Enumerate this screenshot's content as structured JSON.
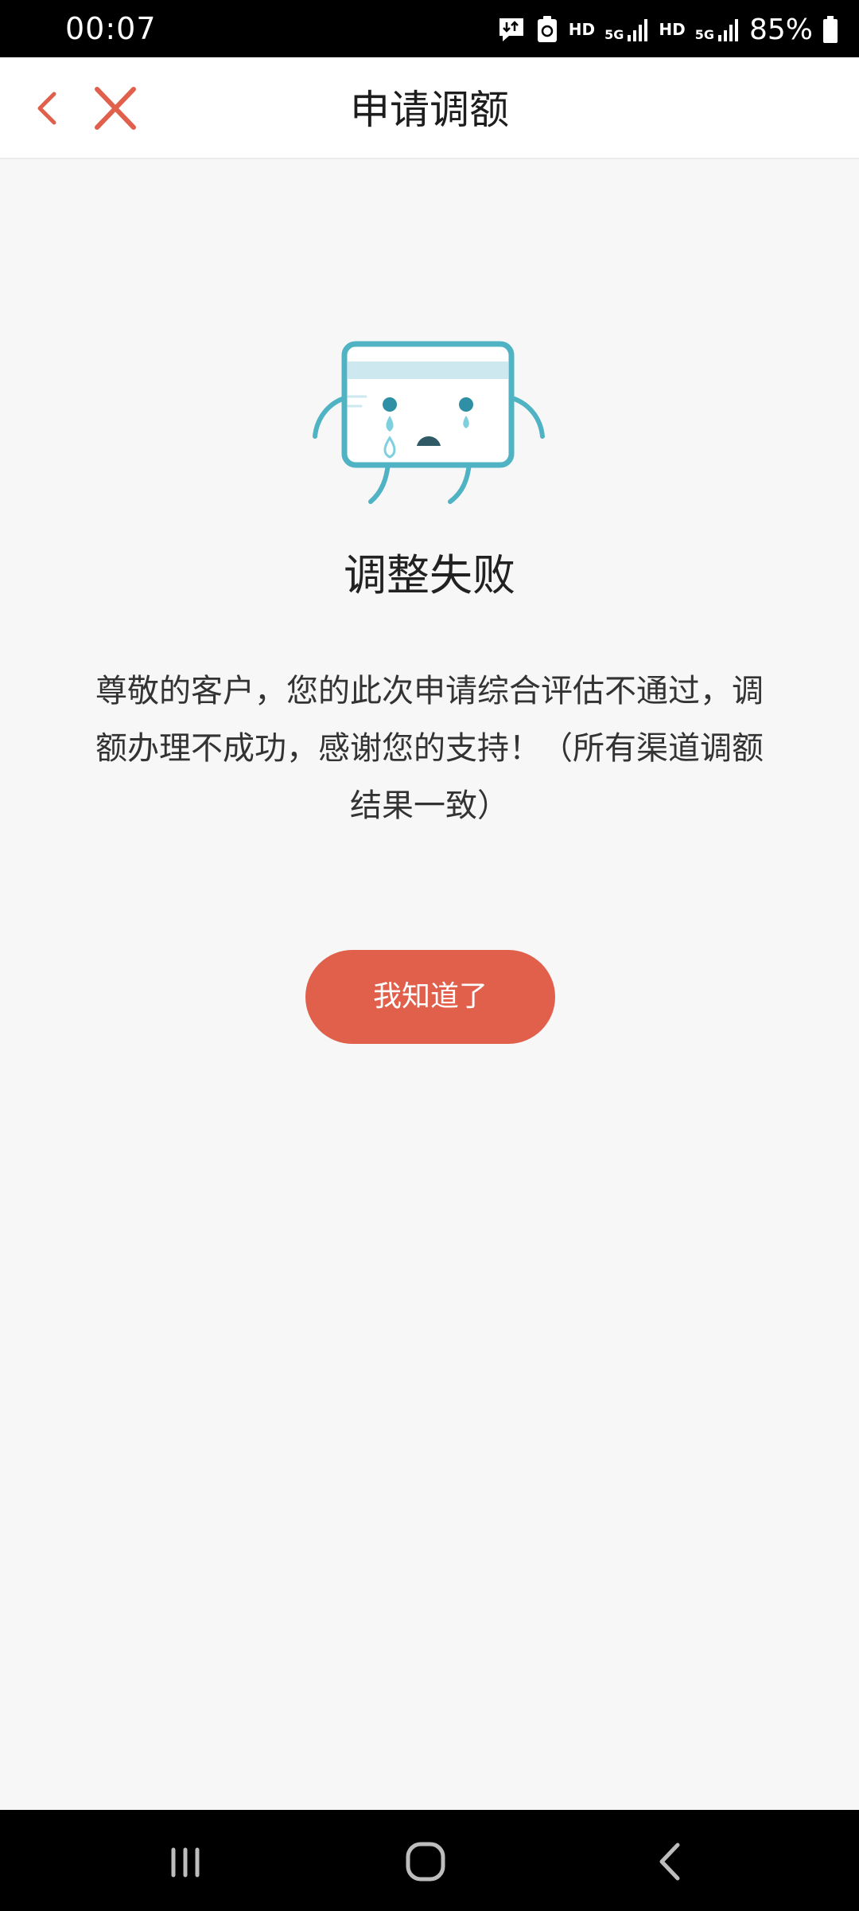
{
  "status_bar": {
    "time": "00:07",
    "hd_1": "HD",
    "net_1": "5G",
    "hd_2": "HD",
    "net_2": "5G",
    "battery": "85%"
  },
  "nav": {
    "title": "申请调额",
    "back_icon": "chevron-left-icon",
    "close_icon": "close-icon",
    "accent_color": "#e0604c"
  },
  "result": {
    "illustration": "crying-card-icon",
    "title": "调整失败",
    "message": "尊敬的客户，您的此次申请综合评估不通过，调额办理不成功，感谢您的支持！（所有渠道调额结果一致）",
    "button_label": "我知道了",
    "button_color": "#e0604c"
  },
  "system_nav": {
    "recent_icon": "recent-apps-icon",
    "home_icon": "home-icon",
    "back_icon": "back-icon"
  }
}
